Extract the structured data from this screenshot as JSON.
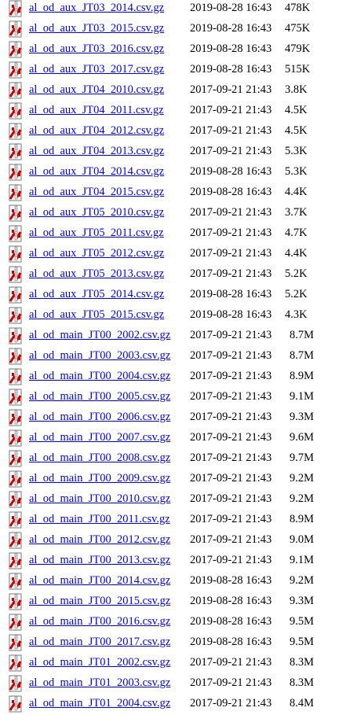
{
  "files": [
    {
      "name": "al_od_aux_JT03_2014.csv.gz",
      "date": "2019-08-28 16:43",
      "size": "478K"
    },
    {
      "name": "al_od_aux_JT03_2015.csv.gz",
      "date": "2019-08-28 16:43",
      "size": "475K"
    },
    {
      "name": "al_od_aux_JT03_2016.csv.gz",
      "date": "2019-08-28 16:43",
      "size": "479K"
    },
    {
      "name": "al_od_aux_JT03_2017.csv.gz",
      "date": "2019-08-28 16:43",
      "size": "515K"
    },
    {
      "name": "al_od_aux_JT04_2010.csv.gz",
      "date": "2017-09-21 21:43",
      "size": "3.8K"
    },
    {
      "name": "al_od_aux_JT04_2011.csv.gz",
      "date": "2017-09-21 21:43",
      "size": "4.5K"
    },
    {
      "name": "al_od_aux_JT04_2012.csv.gz",
      "date": "2017-09-21 21:43",
      "size": "4.5K"
    },
    {
      "name": "al_od_aux_JT04_2013.csv.gz",
      "date": "2017-09-21 21:43",
      "size": "5.3K"
    },
    {
      "name": "al_od_aux_JT04_2014.csv.gz",
      "date": "2019-08-28 16:43",
      "size": "5.3K"
    },
    {
      "name": "al_od_aux_JT04_2015.csv.gz",
      "date": "2019-08-28 16:43",
      "size": "4.4K"
    },
    {
      "name": "al_od_aux_JT05_2010.csv.gz",
      "date": "2017-09-21 21:43",
      "size": "3.7K"
    },
    {
      "name": "al_od_aux_JT05_2011.csv.gz",
      "date": "2017-09-21 21:43",
      "size": "4.7K"
    },
    {
      "name": "al_od_aux_JT05_2012.csv.gz",
      "date": "2017-09-21 21:43",
      "size": "4.4K"
    },
    {
      "name": "al_od_aux_JT05_2013.csv.gz",
      "date": "2017-09-21 21:43",
      "size": "5.2K"
    },
    {
      "name": "al_od_aux_JT05_2014.csv.gz",
      "date": "2019-08-28 16:43",
      "size": "5.2K"
    },
    {
      "name": "al_od_aux_JT05_2015.csv.gz",
      "date": "2019-08-28 16:43",
      "size": "4.3K"
    },
    {
      "name": "al_od_main_JT00_2002.csv.gz",
      "date": "2017-09-21 21:43",
      "size": "8.7M"
    },
    {
      "name": "al_od_main_JT00_2003.csv.gz",
      "date": "2017-09-21 21:43",
      "size": "8.7M"
    },
    {
      "name": "al_od_main_JT00_2004.csv.gz",
      "date": "2017-09-21 21:43",
      "size": "8.9M"
    },
    {
      "name": "al_od_main_JT00_2005.csv.gz",
      "date": "2017-09-21 21:43",
      "size": "9.1M"
    },
    {
      "name": "al_od_main_JT00_2006.csv.gz",
      "date": "2017-09-21 21:43",
      "size": "9.3M"
    },
    {
      "name": "al_od_main_JT00_2007.csv.gz",
      "date": "2017-09-21 21:43",
      "size": "9.6M"
    },
    {
      "name": "al_od_main_JT00_2008.csv.gz",
      "date": "2017-09-21 21:43",
      "size": "9.7M"
    },
    {
      "name": "al_od_main_JT00_2009.csv.gz",
      "date": "2017-09-21 21:43",
      "size": "9.2M"
    },
    {
      "name": "al_od_main_JT00_2010.csv.gz",
      "date": "2017-09-21 21:43",
      "size": "9.2M"
    },
    {
      "name": "al_od_main_JT00_2011.csv.gz",
      "date": "2017-09-21 21:43",
      "size": "8.9M"
    },
    {
      "name": "al_od_main_JT00_2012.csv.gz",
      "date": "2017-09-21 21:43",
      "size": "9.0M"
    },
    {
      "name": "al_od_main_JT00_2013.csv.gz",
      "date": "2017-09-21 21:43",
      "size": "9.1M"
    },
    {
      "name": "al_od_main_JT00_2014.csv.gz",
      "date": "2019-08-28 16:43",
      "size": "9.2M"
    },
    {
      "name": "al_od_main_JT00_2015.csv.gz",
      "date": "2019-08-28 16:43",
      "size": "9.3M"
    },
    {
      "name": "al_od_main_JT00_2016.csv.gz",
      "date": "2019-08-28 16:43",
      "size": "9.5M"
    },
    {
      "name": "al_od_main_JT00_2017.csv.gz",
      "date": "2019-08-28 16:43",
      "size": "9.5M"
    },
    {
      "name": "al_od_main_JT01_2002.csv.gz",
      "date": "2017-09-21 21:43",
      "size": "8.3M"
    },
    {
      "name": "al_od_main_JT01_2003.csv.gz",
      "date": "2017-09-21 21:43",
      "size": "8.3M"
    },
    {
      "name": "al_od_main_JT01_2004.csv.gz",
      "date": "2017-09-21 21:43",
      "size": "8.4M"
    }
  ],
  "icon": {
    "name": "compressed-file-icon",
    "accent": "#cc0000"
  },
  "colors": {
    "link": "#0000ee",
    "text": "#000000",
    "background": "#ffffff"
  }
}
